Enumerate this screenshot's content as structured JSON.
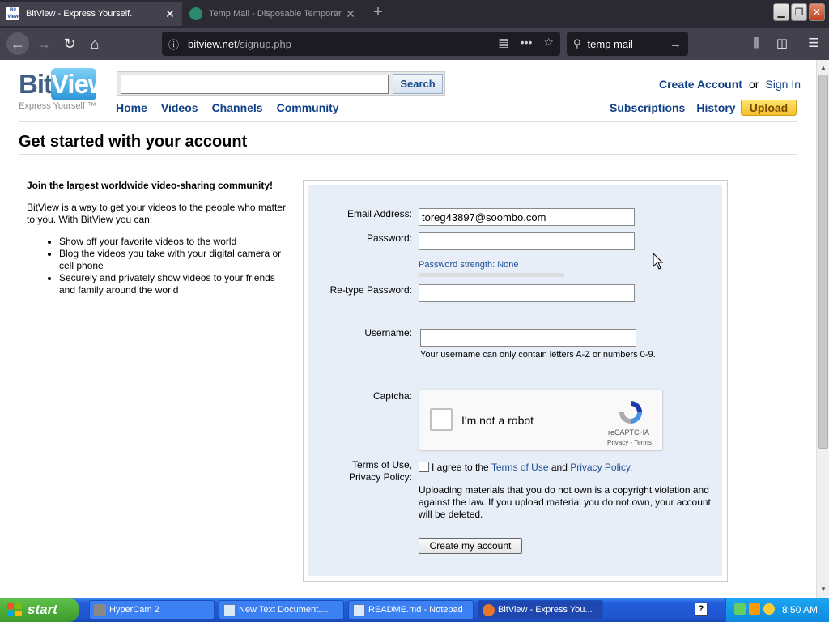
{
  "browser": {
    "tabs": [
      {
        "title": "BitView - Express Yourself.",
        "active": true
      },
      {
        "title": "Temp Mail - Disposable Temporar",
        "active": false
      }
    ],
    "url_domain": "bitview.net",
    "url_path": "/signup.php",
    "search_text": "temp mail"
  },
  "site": {
    "logo_bit": "Bit",
    "logo_view": "View",
    "tagline": "Express Yourself ™",
    "search_button": "Search",
    "search_placeholder": "",
    "nav": [
      "Home",
      "Videos",
      "Channels",
      "Community"
    ],
    "create_account": "Create Account",
    "or": "or",
    "sign_in": "Sign In",
    "subscriptions": "Subscriptions",
    "history": "History",
    "upload": "Upload"
  },
  "page": {
    "heading": "Get started with your account",
    "intro_title": "Join the largest worldwide video-sharing community!",
    "intro_text": "BitView is a way to get your videos to the people who matter to you. With BitView you can:",
    "bullets": [
      "Show off your favorite videos to the world",
      "Blog the videos you take with your digital camera or cell phone",
      "Securely and privately show videos to your friends and family around the world"
    ]
  },
  "form": {
    "email_label": "Email Address:",
    "email_value": "toreg43897@soombo.com",
    "password_label": "Password:",
    "password_strength": "Password strength: None",
    "retype_label": "Re-type Password:",
    "username_label": "Username:",
    "username_note": "Your username can only contain letters A-Z or numbers 0-9.",
    "captcha_label": "Captcha:",
    "captcha_text": "I'm not a robot",
    "captcha_brand": "reCAPTCHA",
    "captcha_links": "Privacy - Terms",
    "terms_label_1": "Terms of Use,",
    "terms_label_2": "Privacy Policy:",
    "agree_prefix": "I agree to the",
    "terms_link": "Terms of Use",
    "and": "and",
    "privacy_link": "Privacy Policy.",
    "upload_warning": "Uploading materials that you do not own is a copyright violation and against the law. If you upload material you do not own, your account will be deleted.",
    "submit": "Create my account"
  },
  "taskbar": {
    "start": "start",
    "items": [
      "HyperCam 2",
      "New Text Document....",
      "README.md - Notepad",
      "BitView - Express You..."
    ],
    "help": "?",
    "time": "8:50 AM"
  },
  "colors": {
    "link_blue": "#0f3f86",
    "form_bg": "#e8eef8",
    "upload_yellow": "#f2c02b"
  }
}
